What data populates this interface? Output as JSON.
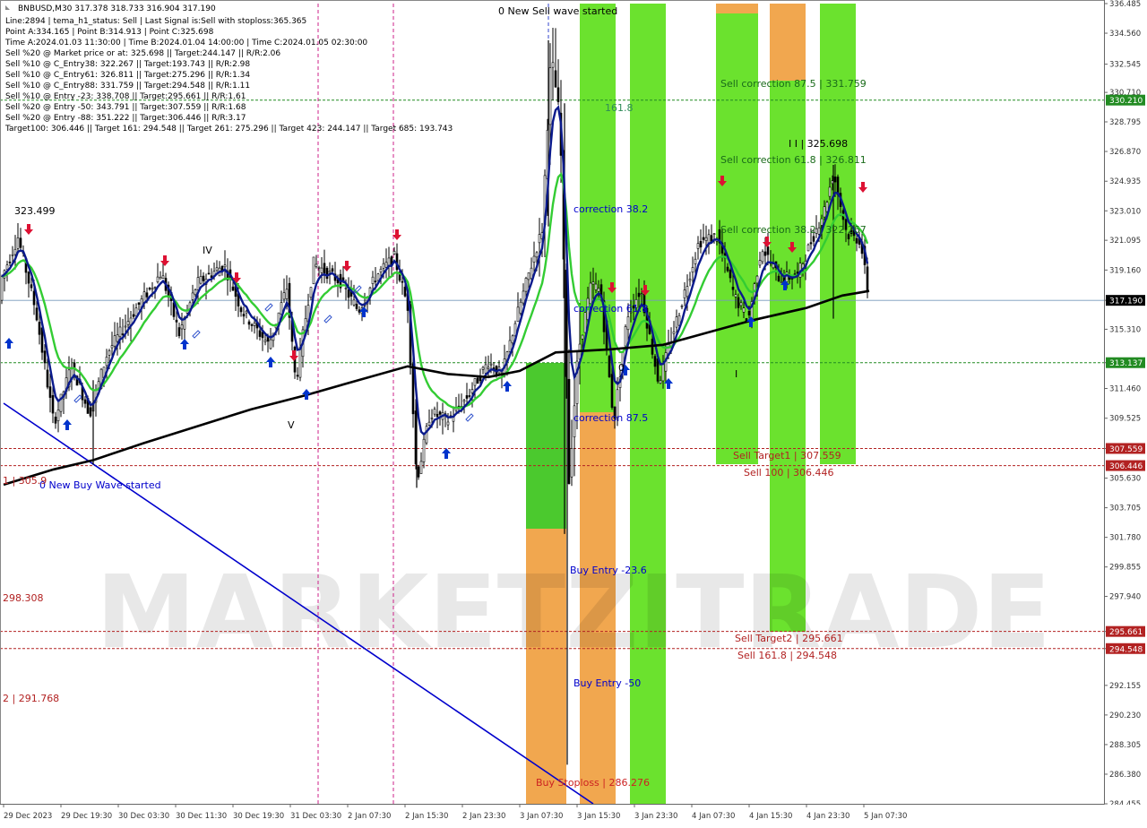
{
  "header": {
    "symbol_line": "BNBUSD,M30  317.378 318.733 316.904 317.190",
    "lines": [
      "Line:2894 | tema_h1_status: Sell | Last Signal is:Sell with stoploss:365.365",
      "Point A:334.165 | Point B:314.913 | Point C:325.698",
      "Time A:2024.01.03 11:30:00 | Time B:2024.01.04 14:00:00 | Time C:2024.01.05 02:30:00",
      "Sell %20 @ Market price or at: 325.698 || Target:244.147 || R/R:2.06",
      "Sell %10 @ C_Entry38: 322.267 || Target:193.743 || R/R:2.98",
      "Sell %10 @ C_Entry61: 326.811 || Target:275.296 || R/R:1.34",
      "Sell %10 @ C_Entry88: 331.759 || Target:294.548 || R/R:1.11",
      "Sell %10 @ Entry -23: 338.708 || Target:295.661 || R/R:1.61",
      "Sell %20 @ Entry -50: 343.791 || Target:307.559 || R/R:1.68",
      "Sell %20 @ Entry -88: 351.222 || Target:306.446 || R/R:3.17",
      "Target100: 306.446 || Target 161: 294.548 || Target 261: 275.296 || Target 423: 244.147 || Target 685: 193.743"
    ]
  },
  "watermark": "MARKETZITRADE",
  "colors": {
    "background": "#ffffff",
    "green_zone": "#5ee01c",
    "green_zone_dark": "#3cc41c",
    "orange_zone": "#f0a040",
    "red_line": "#b22222",
    "green_line": "#228b22",
    "blue": "#0000cc",
    "navy": "#0a1a8c",
    "ma_green": "#33cc33",
    "arrow_red": "#dd1133",
    "arrow_blue": "#0033cc"
  },
  "chart_data": {
    "type": "candlestick",
    "symbol": "BNBUSD",
    "timeframe": "M30",
    "last_price": 317.19,
    "ylim": [
      284.455,
      336.485
    ],
    "y_ticks": [
      "336.485",
      "334.560",
      "332.545",
      "330.710",
      "328.795",
      "326.870",
      "324.935",
      "323.010",
      "321.095",
      "319.160",
      "317.190",
      "315.310",
      "313.137",
      "311.460",
      "309.525",
      "307.559",
      "305.630",
      "303.705",
      "301.780",
      "299.855",
      "297.940",
      "295.661",
      "294.548",
      "292.155",
      "290.230",
      "288.305",
      "286.380",
      "284.455"
    ],
    "x_ticks": [
      "29 Dec 2023",
      "29 Dec 19:30",
      "30 Dec 03:30",
      "30 Dec 11:30",
      "30 Dec 19:30",
      "31 Dec 03:30",
      "2 Jan 07:30",
      "2 Jan 15:30",
      "2 Jan 23:30",
      "3 Jan 07:30",
      "3 Jan 15:30",
      "3 Jan 23:30",
      "4 Jan 07:30",
      "4 Jan 15:30",
      "4 Jan 23:30",
      "5 Jan 07:30"
    ],
    "price_badges": [
      {
        "label": "330.210",
        "value": 330.21,
        "color": "#228b22"
      },
      {
        "label": "317.190",
        "value": 317.19,
        "color": "#000000"
      },
      {
        "label": "313.137",
        "value": 313.137,
        "color": "#228b22"
      },
      {
        "label": "307.559",
        "value": 307.559,
        "color": "#b22222"
      },
      {
        "label": "306.446",
        "value": 306.446,
        "color": "#b22222"
      },
      {
        "label": "295.661",
        "value": 295.661,
        "color": "#b22222"
      },
      {
        "label": "294.548",
        "value": 294.548,
        "color": "#b22222"
      }
    ],
    "horizontal_lines": [
      {
        "value": 330.21,
        "color": "#228b22"
      },
      {
        "value": 313.137,
        "color": "#228b22"
      },
      {
        "value": 307.559,
        "color": "#b22222"
      },
      {
        "value": 306.446,
        "color": "#b22222"
      },
      {
        "value": 295.661,
        "color": "#b22222"
      },
      {
        "value": 294.548,
        "color": "#b22222"
      }
    ],
    "annotations": [
      {
        "text": "0 New Sell wave started",
        "color": "#000000"
      },
      {
        "text": "161.8",
        "color": "#2e8b57"
      },
      {
        "text": "correction 38.2",
        "color": "#0000cc"
      },
      {
        "text": "correction 61.8",
        "color": "#0000cc"
      },
      {
        "text": "correction 87.5",
        "color": "#0000cc"
      },
      {
        "text": "Buy Entry -23.6",
        "color": "#0000cc"
      },
      {
        "text": "Buy Entry -50",
        "color": "#0000cc"
      },
      {
        "text": "Buy Stoploss | 286.276",
        "color": "#cc2222"
      },
      {
        "text": "Sell correction 87.5 | 331.759",
        "color": "#1a6b1a"
      },
      {
        "text": "Sell correction 61.8 | 326.811",
        "color": "#1a6b1a"
      },
      {
        "text": "Sell correction 38.2 | 322.267",
        "color": "#1a6b1a"
      },
      {
        "text": "I I | 325.698",
        "color": "#000000"
      },
      {
        "text": "Sell Target1 | 307.559",
        "color": "#b22222"
      },
      {
        "text": "Sell 100 | 306.446",
        "color": "#b22222"
      },
      {
        "text": "Sell Target2 | 295.661",
        "color": "#b22222"
      },
      {
        "text": "Sell 161.8 | 294.548",
        "color": "#b22222"
      },
      {
        "text": "0 New Buy Wave started",
        "color": "#0000cc"
      },
      {
        "text": "1 | 305.9",
        "color": "#b22222"
      },
      {
        "text": "298.308",
        "color": "#b22222"
      },
      {
        "text": "2 | 291.768",
        "color": "#b22222"
      },
      {
        "text": "323.499",
        "color": "#000000"
      },
      {
        "text": "IV",
        "color": "#000000"
      },
      {
        "text": "V",
        "color": "#000000"
      },
      {
        "text": "I",
        "color": "#000000"
      },
      {
        "text": "0",
        "color": "#000000"
      }
    ]
  }
}
